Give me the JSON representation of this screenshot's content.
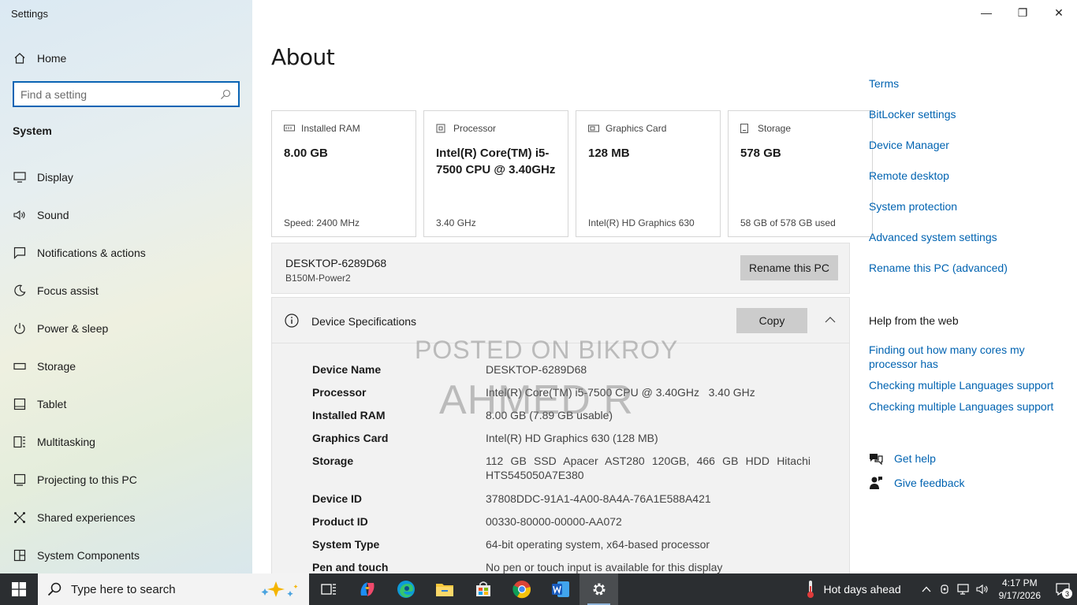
{
  "app": {
    "title": "Settings"
  },
  "sidebar": {
    "home_label": "Home",
    "search_placeholder": "Find a setting",
    "section_title": "System",
    "items": [
      {
        "label": "Display",
        "icon": "monitor-icon"
      },
      {
        "label": "Sound",
        "icon": "speaker-icon"
      },
      {
        "label": "Notifications & actions",
        "icon": "message-icon"
      },
      {
        "label": "Focus assist",
        "icon": "moon-icon"
      },
      {
        "label": "Power & sleep",
        "icon": "power-icon"
      },
      {
        "label": "Storage",
        "icon": "drive-icon"
      },
      {
        "label": "Tablet",
        "icon": "tablet-icon"
      },
      {
        "label": "Multitasking",
        "icon": "multitask-icon"
      },
      {
        "label": "Projecting to this PC",
        "icon": "projector-icon"
      },
      {
        "label": "Shared experiences",
        "icon": "share-icon"
      },
      {
        "label": "System Components",
        "icon": "components-icon"
      }
    ]
  },
  "window_controls": {
    "minimize": "—",
    "restore": "❐",
    "close": "✕"
  },
  "main": {
    "page_title": "About",
    "cards": [
      {
        "label": "Installed RAM",
        "value": "8.00 GB",
        "sub": "Speed: 2400 MHz",
        "icon": "ram-icon"
      },
      {
        "label": "Processor",
        "value": "Intel(R) Core(TM) i5-7500 CPU @ 3.40GHz",
        "sub": "3.40 GHz",
        "icon": "cpu-icon"
      },
      {
        "label": "Graphics Card",
        "value": "128 MB",
        "sub": "Intel(R) HD Graphics 630",
        "icon": "gpu-icon"
      },
      {
        "label": "Storage",
        "value": "578 GB",
        "sub": "58 GB of 578 GB used",
        "icon": "storage-icon"
      }
    ],
    "pc": {
      "name": "DESKTOP-6289D68",
      "model": "B150M-Power2",
      "rename_label": "Rename this PC"
    },
    "specs": {
      "title": "Device Specifications",
      "copy_label": "Copy",
      "rows": [
        {
          "key": "Device Name",
          "value": "DESKTOP-6289D68"
        },
        {
          "key": "Processor",
          "value": "Intel(R) Core(TM) i5-7500 CPU @ 3.40GHz   3.40 GHz"
        },
        {
          "key": "Installed RAM",
          "value": "8.00 GB (7.89 GB usable)"
        },
        {
          "key": "Graphics Card",
          "value": "Intel(R) HD Graphics 630 (128 MB)"
        },
        {
          "key": "Storage",
          "value": "112 GB SSD Apacer AST280 120GB, 466 GB HDD Hitachi HTS545050A7E380"
        },
        {
          "key": "Device ID",
          "value": "37808DDC-91A1-4A00-8A4A-76A1E588A421"
        },
        {
          "key": "Product ID",
          "value": "00330-80000-00000-AA072"
        },
        {
          "key": "System Type",
          "value": "64-bit operating system, x64-based processor"
        },
        {
          "key": "Pen and touch",
          "value": "No pen or touch input is available for this display"
        }
      ]
    },
    "watermark": {
      "line1": "POSTED ON BIKROY",
      "line2": "AHMED R"
    }
  },
  "related": {
    "links": [
      "Terms",
      "BitLocker settings",
      "Device Manager",
      "Remote desktop",
      "System protection",
      "Advanced system settings",
      "Rename this PC (advanced)"
    ],
    "help_title": "Help from the web",
    "web_links": [
      "Finding out how many cores my processor has",
      "Checking multiple Languages support",
      "Checking multiple Languages support"
    ],
    "get_help": "Get help",
    "give_feedback": "Give feedback"
  },
  "taskbar": {
    "search_placeholder": "Type here to search",
    "weather": "Hot days ahead",
    "time": "4:17 PM",
    "date": "9/17/2026",
    "notification_count": "3"
  }
}
